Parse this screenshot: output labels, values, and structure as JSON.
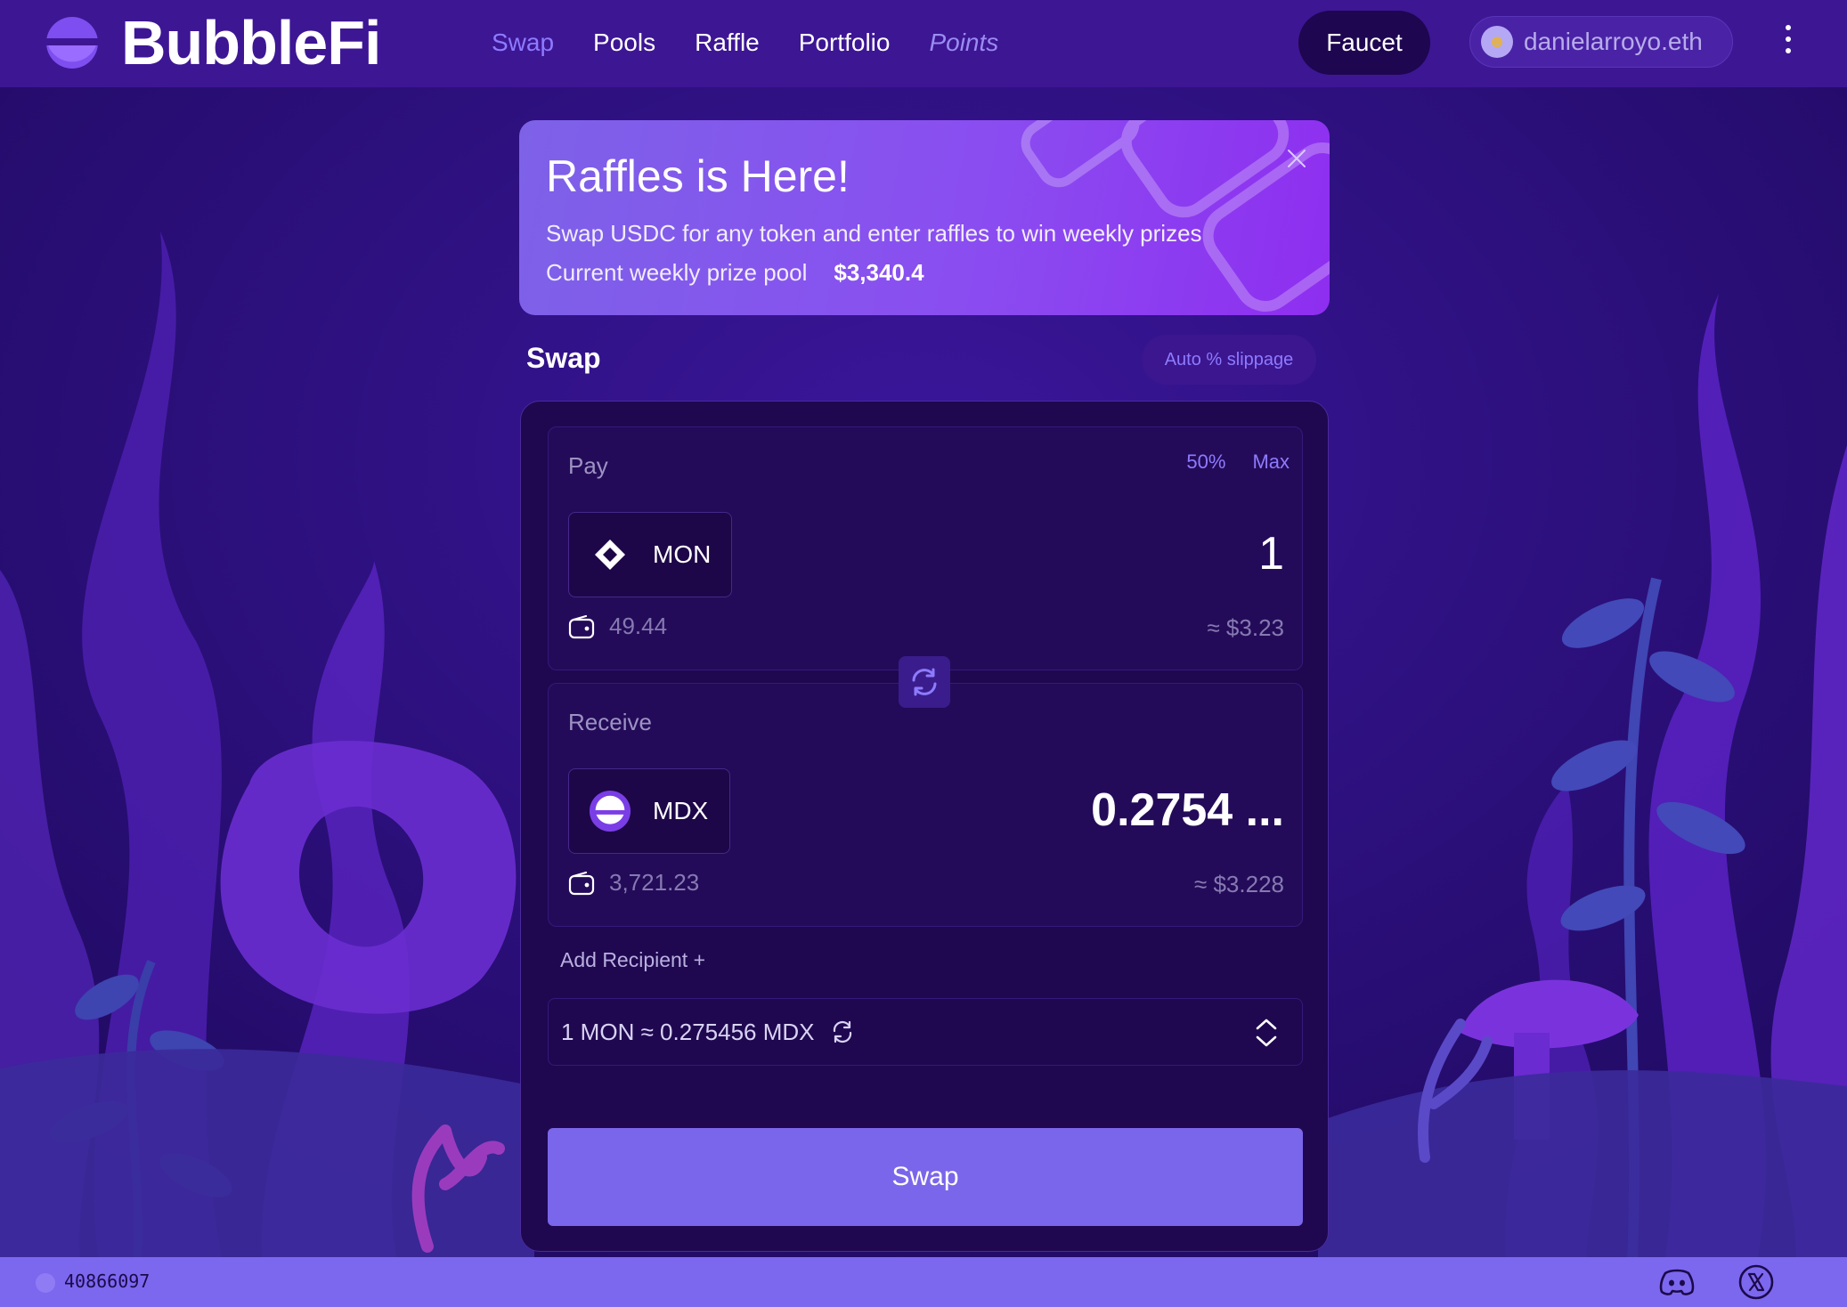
{
  "app": {
    "name": "BubbleFi"
  },
  "nav": {
    "items": [
      {
        "label": "Swap",
        "active": true
      },
      {
        "label": "Pools"
      },
      {
        "label": "Raffle"
      },
      {
        "label": "Portfolio"
      },
      {
        "label": "Points"
      }
    ]
  },
  "header": {
    "faucet_label": "Faucet",
    "account": "danielarroyo.eth",
    "menu_icon": "kebab-menu-icon"
  },
  "banner": {
    "title": "Raffles is Here!",
    "description": "Swap USDC for any token and enter raffles to win weekly prizes",
    "pool_label": "Current weekly prize pool",
    "pool_value": "$3,340.4"
  },
  "swap": {
    "title": "Swap",
    "slippage_label": "Auto % slippage",
    "pay": {
      "label": "Pay",
      "pct_50": "50%",
      "max": "Max",
      "token": "MON",
      "amount": "1",
      "balance": "49.44",
      "usd": "≈ $3.23"
    },
    "receive": {
      "label": "Receive",
      "token": "MDX",
      "amount": "0.2754 ...",
      "balance": "3,721.23",
      "usd": "≈ $3.228"
    },
    "add_recipient": "Add Recipient +",
    "rate": "1 MON ≈ 0.275456 MDX",
    "submit_label": "Swap"
  },
  "footer": {
    "block_number": "40866097"
  },
  "colors": {
    "background": "#2a0f78",
    "header": "#3d1694",
    "accent": "#8d7bff",
    "swap_button": "#7a66ea",
    "card": "#1f0850",
    "footer": "#7c68ef"
  }
}
